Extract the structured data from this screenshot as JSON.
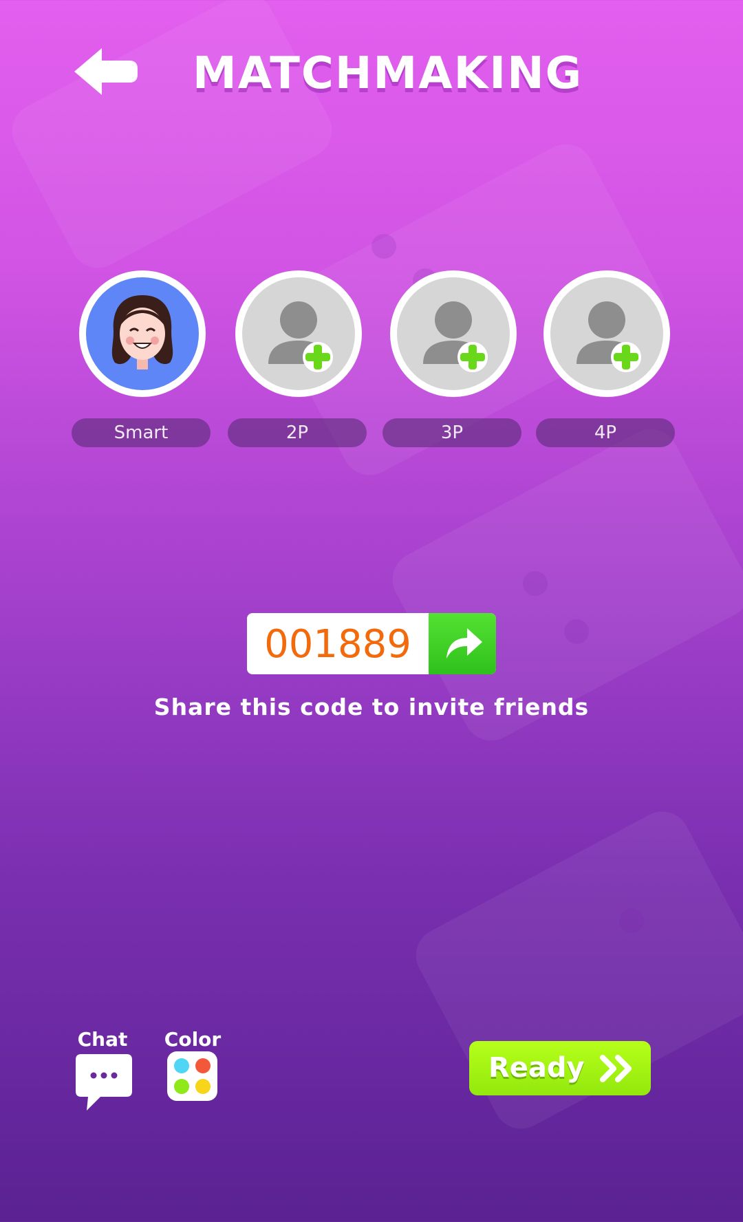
{
  "header": {
    "title": "MATCHMAKING",
    "back_icon": "back-arrow-icon"
  },
  "slots": [
    {
      "label": "Smart",
      "state": "player",
      "icon": "girl-avatar"
    },
    {
      "label": "2P",
      "state": "empty",
      "icon": "add-player-icon"
    },
    {
      "label": "3P",
      "state": "empty",
      "icon": "add-player-icon"
    },
    {
      "label": "4P",
      "state": "empty",
      "icon": "add-player-icon"
    }
  ],
  "invite": {
    "code": "001889",
    "share_icon": "share-arrow-icon",
    "hint": "Share this code to invite friends"
  },
  "tools": {
    "chat_label": "Chat",
    "chat_icon": "chat-bubble-icon",
    "color_label": "Color",
    "color_icon": "color-palette-icon",
    "palette": [
      "#4fd6f5",
      "#f4583a",
      "#8ee81a",
      "#f7d51a"
    ]
  },
  "ready_button": {
    "label": "Ready",
    "icon": "double-chevron-right-icon"
  },
  "colors": {
    "code_text": "#f26a0c",
    "share_green": "#3fd024",
    "ready_green": "#a6f213"
  }
}
